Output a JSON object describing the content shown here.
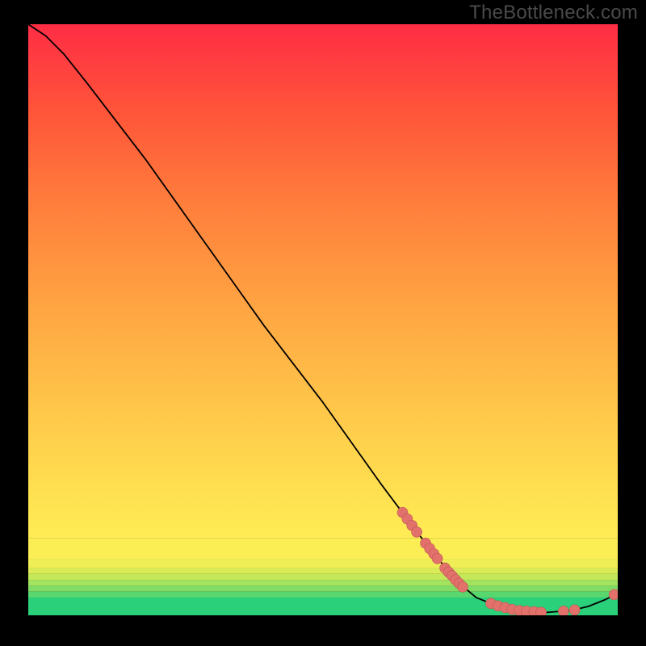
{
  "watermark": "TheBottleneck.com",
  "chart_data": {
    "type": "line",
    "title": "",
    "xlabel": "",
    "ylabel": "",
    "xlim": [
      0,
      100
    ],
    "ylim": [
      0,
      100
    ],
    "background_bands": [
      {
        "y0": 0,
        "y1": 3,
        "color": "#2ad07a"
      },
      {
        "y0": 3,
        "y1": 4,
        "color": "#58d76f"
      },
      {
        "y0": 4,
        "y1": 5,
        "color": "#7fdd66"
      },
      {
        "y0": 5,
        "y1": 6,
        "color": "#a3e35f"
      },
      {
        "y0": 6,
        "y1": 7,
        "color": "#c3e85a"
      },
      {
        "y0": 7,
        "y1": 8,
        "color": "#dbeb57"
      },
      {
        "y0": 8,
        "y1": 9.5,
        "color": "#efee56"
      },
      {
        "y0": 9.5,
        "y1": 13,
        "color": "#fbee55"
      },
      {
        "y0": 13,
        "y1": 100,
        "color": "gradient-main"
      }
    ],
    "gradient_main_stops": [
      {
        "y": 13,
        "color": "#ffed54"
      },
      {
        "y": 30,
        "color": "#ffd04c"
      },
      {
        "y": 50,
        "color": "#ffa943"
      },
      {
        "y": 70,
        "color": "#ff7d3c"
      },
      {
        "y": 85,
        "color": "#ff5539"
      },
      {
        "y": 100,
        "color": "#ff2d45"
      }
    ],
    "curve": [
      {
        "x": 0,
        "y": 100
      },
      {
        "x": 3,
        "y": 98
      },
      {
        "x": 6,
        "y": 95
      },
      {
        "x": 10,
        "y": 90
      },
      {
        "x": 20,
        "y": 77
      },
      {
        "x": 30,
        "y": 63
      },
      {
        "x": 40,
        "y": 49
      },
      {
        "x": 50,
        "y": 36
      },
      {
        "x": 60,
        "y": 22
      },
      {
        "x": 66,
        "y": 14
      },
      {
        "x": 70,
        "y": 9
      },
      {
        "x": 73,
        "y": 5.5
      },
      {
        "x": 76,
        "y": 3
      },
      {
        "x": 80,
        "y": 1.4
      },
      {
        "x": 84,
        "y": 0.7
      },
      {
        "x": 88,
        "y": 0.5
      },
      {
        "x": 92,
        "y": 0.8
      },
      {
        "x": 95,
        "y": 1.5
      },
      {
        "x": 98,
        "y": 2.7
      },
      {
        "x": 100,
        "y": 3.8
      }
    ],
    "markers": [
      {
        "x": 63.5,
        "y": 17.4
      },
      {
        "x": 64.3,
        "y": 16.3
      },
      {
        "x": 65.1,
        "y": 15.2
      },
      {
        "x": 65.9,
        "y": 14.1
      },
      {
        "x": 67.4,
        "y": 12.2
      },
      {
        "x": 68.1,
        "y": 11.3
      },
      {
        "x": 68.8,
        "y": 10.4
      },
      {
        "x": 69.4,
        "y": 9.6
      },
      {
        "x": 70.7,
        "y": 8.0
      },
      {
        "x": 71.3,
        "y": 7.3
      },
      {
        "x": 71.9,
        "y": 6.7
      },
      {
        "x": 72.5,
        "y": 6.0
      },
      {
        "x": 73.1,
        "y": 5.4
      },
      {
        "x": 73.7,
        "y": 4.8
      },
      {
        "x": 78.5,
        "y": 2.0
      },
      {
        "x": 79.7,
        "y": 1.6
      },
      {
        "x": 80.9,
        "y": 1.3
      },
      {
        "x": 82.1,
        "y": 1.0
      },
      {
        "x": 83.3,
        "y": 0.8
      },
      {
        "x": 84.5,
        "y": 0.7
      },
      {
        "x": 85.8,
        "y": 0.6
      },
      {
        "x": 87.0,
        "y": 0.5
      },
      {
        "x": 90.8,
        "y": 0.7
      },
      {
        "x": 92.7,
        "y": 0.9
      },
      {
        "x": 99.4,
        "y": 3.5
      }
    ],
    "colors": {
      "curve": "#000000",
      "marker_fill": "#e2706b",
      "marker_stroke": "#c05a55"
    }
  }
}
